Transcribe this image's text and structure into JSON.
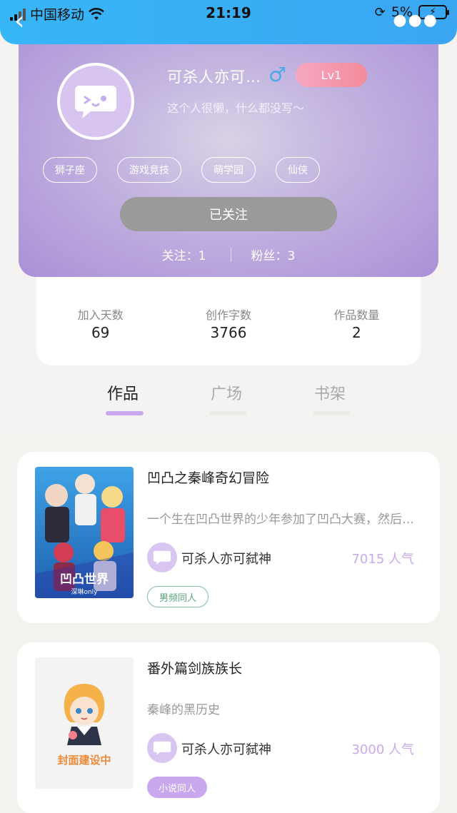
{
  "status_bar": {
    "carrier": "中国移动",
    "time": "21:19",
    "battery": "5%"
  },
  "profile": {
    "nickname": "可杀人亦可…",
    "gender_symbol": "♂",
    "level": "Lv1",
    "bio": "这个人很懒，什么都没写～",
    "tags": [
      "狮子座",
      "游戏竞技",
      "萌学园",
      "仙侠"
    ],
    "follow_button": "已关注",
    "following": "关注：1",
    "followers": "粉丝：3"
  },
  "stats": [
    {
      "label": "加入天数",
      "value": "69"
    },
    {
      "label": "创作字数",
      "value": "3766"
    },
    {
      "label": "作品数量",
      "value": "2"
    }
  ],
  "tabs": [
    {
      "label": "作品",
      "active": true
    },
    {
      "label": "广场",
      "active": false
    },
    {
      "label": "书架",
      "active": false
    }
  ],
  "works": [
    {
      "title": "凹凸之秦峰奇幻冒险",
      "description": "一个生在凹凸世界的少年参加了凹凸大赛，然后……",
      "author": "可杀人亦可弑神",
      "popularity": "7015 人气",
      "tag": "男频同人",
      "cover_text": "凹凸世界",
      "cover_subtext": "深琳only"
    },
    {
      "title": "番外篇剑族族长",
      "description": "秦峰的黑历史",
      "author": "可杀人亦可弑神",
      "popularity": "3000 人气",
      "tag": "小说同人",
      "cover_text": "封面建设中"
    }
  ],
  "colors": {
    "status_bar": "#37b6f7",
    "accent_purple": "#c9a8ef",
    "popularity": "#c8a9ec"
  }
}
